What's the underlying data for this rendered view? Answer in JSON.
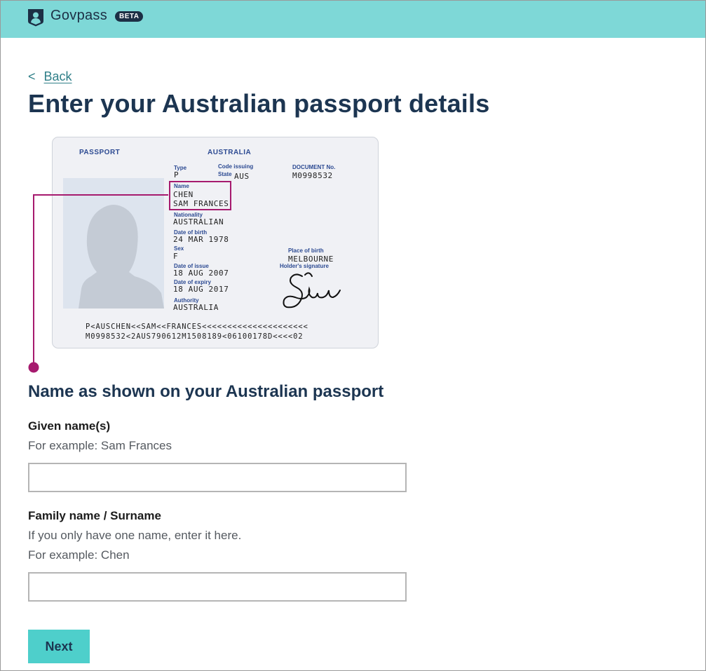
{
  "header": {
    "brand": "Govpass",
    "badge": "BETA",
    "background_color": "#7ed8d7",
    "logo_icon": "user-shield-icon"
  },
  "nav": {
    "back_chevron": "<",
    "back_label": "Back"
  },
  "page": {
    "title": "Enter your Australian passport details"
  },
  "passport": {
    "passport_label": "PASSPORT",
    "country_label": "AUSTRALIA",
    "type_label": "Type",
    "type_value": "P",
    "code_label_line1": "Code issuing",
    "code_label_line2": "State",
    "code_value": "AUS",
    "document_label": "DOCUMENT No.",
    "document_value": "M0998532",
    "name_label": "Name",
    "surname_value": "CHEN",
    "given_value": "SAM FRANCES",
    "nationality_label": "Nationality",
    "nationality_value": "AUSTRALIAN",
    "dob_label": "Date of birth",
    "dob_value": "24 MAR 1978",
    "sex_label": "Sex",
    "sex_value": "F",
    "pob_label": "Place of birth",
    "pob_value": "MELBOURNE",
    "signature_label": "Holder's signature",
    "issue_label": "Date of issue",
    "issue_value": "18 AUG 2007",
    "expiry_label": "Date of expiry",
    "expiry_value": "18 AUG 2017",
    "authority_label": "Authority",
    "authority_value": "AUSTRALIA",
    "mrz_line1": "P<AUSCHEN<<SAM<<FRANCES<<<<<<<<<<<<<<<<<<<<<",
    "mrz_line2": "M0998532<2AUS790612M1508189<06100178D<<<<02",
    "highlight_color": "#a61a6e"
  },
  "form": {
    "section_title": "Name as shown on your Australian passport",
    "given": {
      "label": "Given name(s)",
      "hint": "For example: Sam Frances",
      "value": ""
    },
    "family": {
      "label": "Family name / Surname",
      "hint1": "If you only have one name, enter it here.",
      "hint2": "For example: Chen",
      "value": ""
    },
    "next_label": "Next",
    "accent_color": "#4ecfcb"
  }
}
